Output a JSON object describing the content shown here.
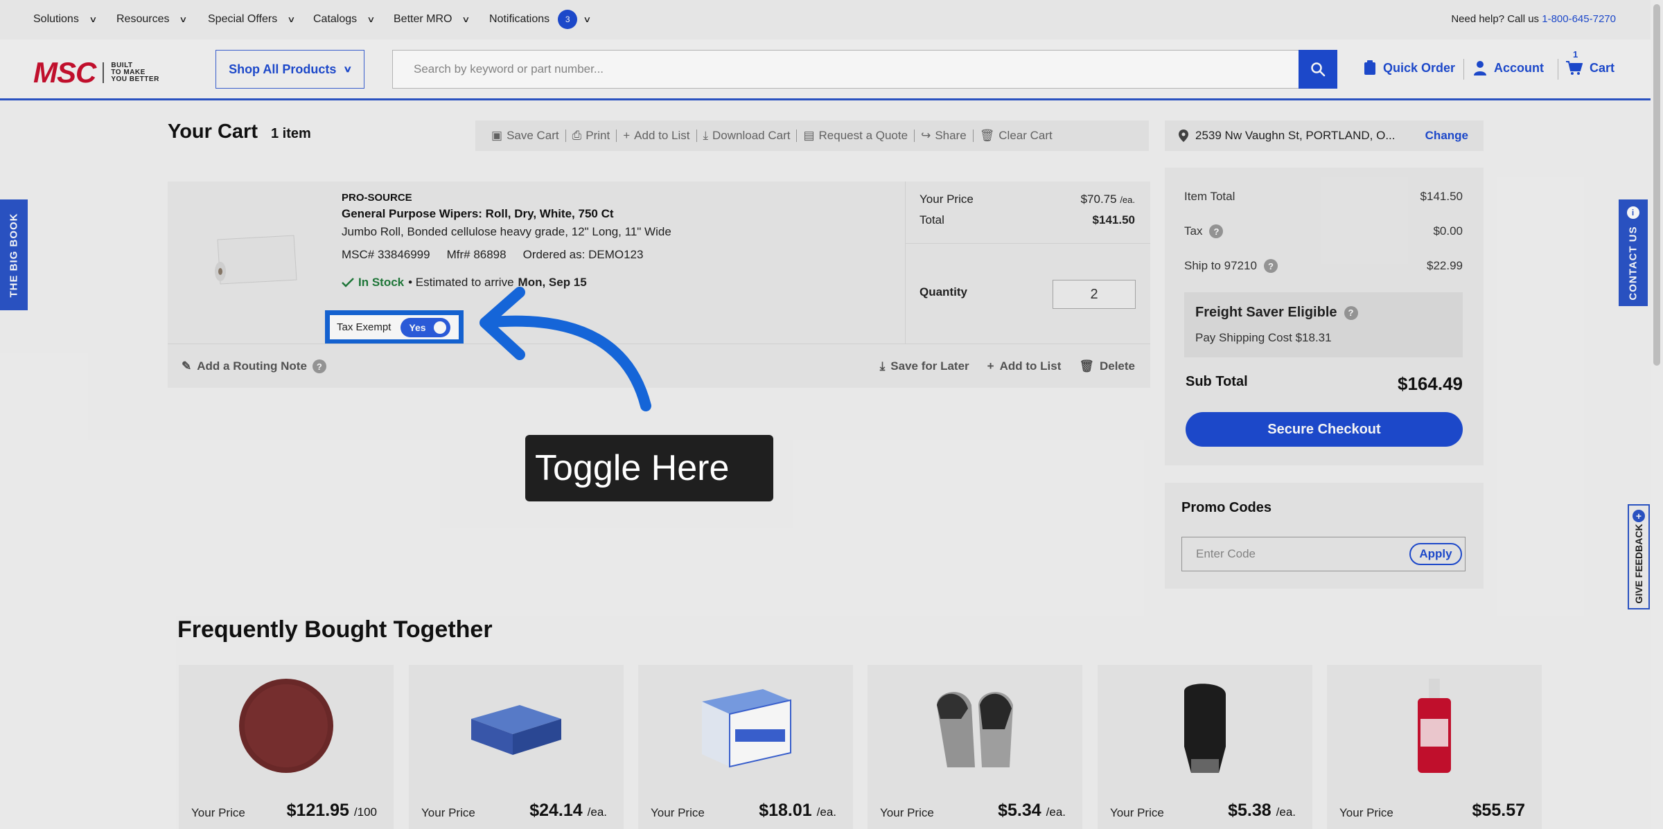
{
  "utility": {
    "items": [
      "Solutions",
      "Resources",
      "Special Offers",
      "Catalogs",
      "Better MRO",
      "Notifications"
    ],
    "notification_count": "3",
    "help_prefix": "Need help? Call us",
    "help_phone": "1-800-645-7270"
  },
  "header": {
    "logo_text": "MSC",
    "logo_tag_1": "BUILT",
    "logo_tag_2": "TO MAKE",
    "logo_tag_3": "YOU BETTER",
    "shop_all": "Shop All Products",
    "search_placeholder": "Search by keyword or part number...",
    "quick_order": "Quick Order",
    "account": "Account",
    "cart": "Cart",
    "cart_count": "1"
  },
  "cart": {
    "title": "Your Cart",
    "count_label": "1 item",
    "toolbar": [
      "Save Cart",
      "Print",
      "Add to List",
      "Download Cart",
      "Request a Quote",
      "Share",
      "Clear Cart"
    ],
    "address": "2539 Nw Vaughn St, PORTLAND, O...",
    "address_change": "Change"
  },
  "item": {
    "brand": "PRO-SOURCE",
    "title": "General Purpose Wipers: Roll, Dry, White, 750 Ct",
    "description": "Jumbo Roll, Bonded cellulose heavy grade, 12\" Long, 11\" Wide",
    "msc": "MSC# 33846999",
    "mfr": "Mfr# 86898",
    "ordered_as": "Ordered as: DEMO123",
    "stock": "In Stock",
    "arrive_prefix": "• Estimated to arrive",
    "arrive_date": "Mon, Sep 15",
    "tax_exempt_label": "Tax Exempt",
    "tax_exempt_value": "Yes",
    "your_price_label": "Your Price",
    "your_price": "$70.75",
    "price_unit": "/ea.",
    "total_label": "Total",
    "total": "$141.50",
    "quantity_label": "Quantity",
    "quantity": "2",
    "routing_note": "Add a Routing Note",
    "save_later": "Save for Later",
    "add_list": "Add to List",
    "delete": "Delete"
  },
  "summary": {
    "item_total_label": "Item Total",
    "item_total": "$141.50",
    "tax_label": "Tax",
    "tax": "$0.00",
    "ship_label": "Ship to 97210",
    "ship": "$22.99",
    "freight_title": "Freight Saver Eligible",
    "freight_sub": "Pay Shipping Cost $18.31",
    "subtotal_label": "Sub Total",
    "subtotal": "$164.49",
    "checkout": "Secure Checkout"
  },
  "promo": {
    "title": "Promo Codes",
    "placeholder": "Enter Code",
    "apply": "Apply"
  },
  "side": {
    "big_book": "THE BIG BOOK",
    "contact": "CONTACT US",
    "feedback": "GIVE FEEDBACK"
  },
  "fbt": {
    "title": "Frequently Bought Together",
    "price_label": "Your Price",
    "products": [
      {
        "price": "$121.95",
        "unit": "/100",
        "icon": "disc-icon"
      },
      {
        "price": "$24.14",
        "unit": "/ea.",
        "icon": "box-icon"
      },
      {
        "price": "$18.01",
        "unit": "/ea.",
        "icon": "battery-box-icon"
      },
      {
        "price": "$5.34",
        "unit": "/ea.",
        "icon": "glove-icon"
      },
      {
        "price": "$5.38",
        "unit": "/ea.",
        "icon": "black-glove-icon"
      },
      {
        "price": "$55.57",
        "unit": "",
        "icon": "bottle-icon"
      }
    ]
  },
  "annotation": {
    "callout": "Toggle Here"
  },
  "colors": {
    "brand_blue": "#1e4bd2",
    "logo_red": "#c8102e",
    "in_stock_green": "#1f7a3a",
    "highlight_blue": "#1565d8"
  }
}
